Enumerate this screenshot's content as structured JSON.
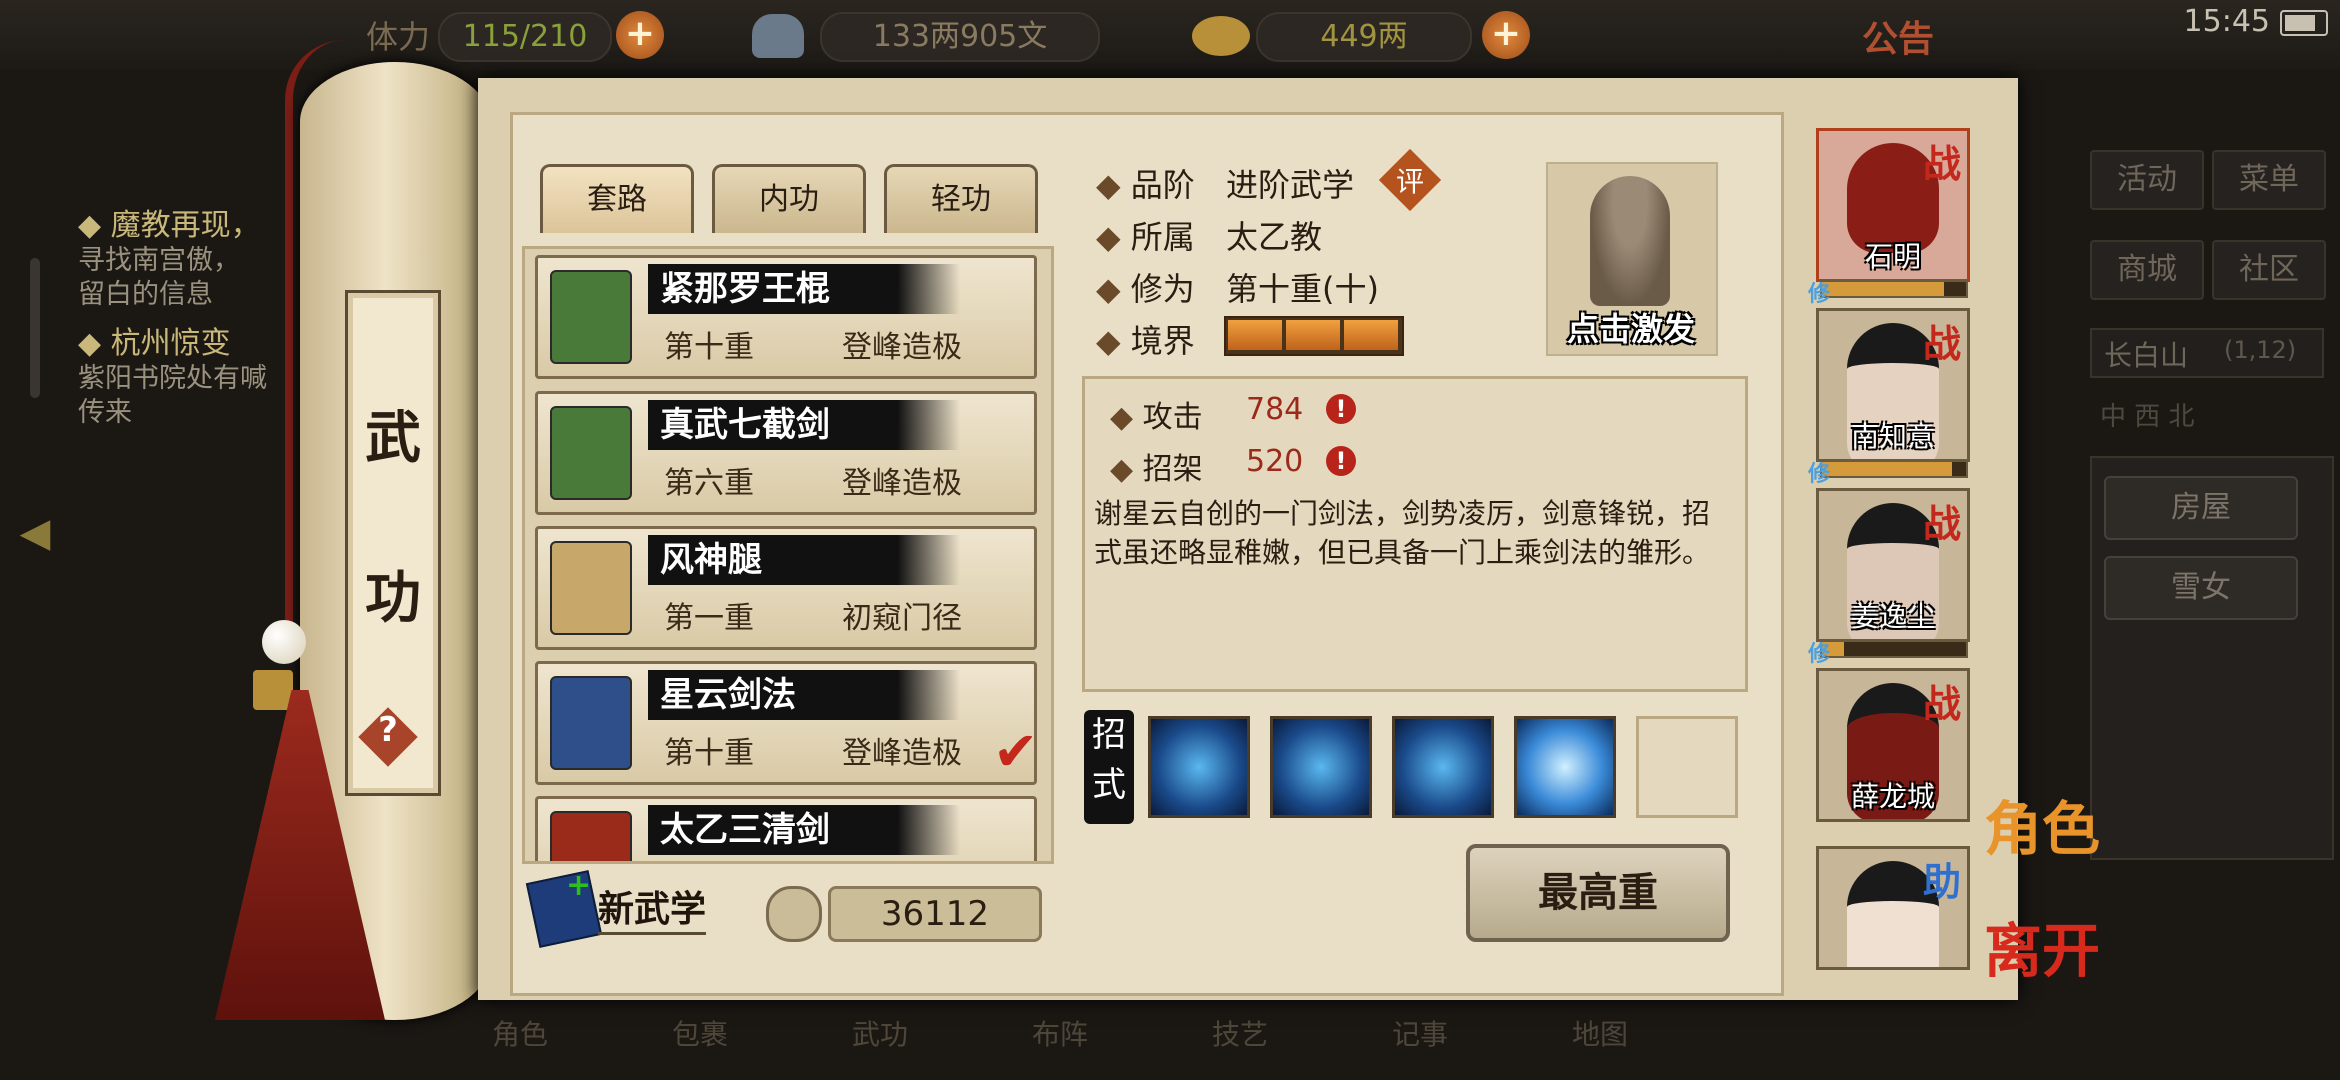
{
  "status_bar": {
    "stamina_label": "体力",
    "stamina_value": "115/210",
    "money": "133两905文",
    "gold": "449两",
    "notice": "公告",
    "clock": "15:45"
  },
  "quests": [
    {
      "title": "◆ 魔教再现，",
      "text": "寻找南宫傲，\n留白的信息"
    },
    {
      "title": "◆ 杭州惊变",
      "text": "紫阳书院处有喊\n传来"
    }
  ],
  "scroll_label": {
    "char1": "武",
    "char2": "功",
    "help": "?"
  },
  "tabs": [
    "套路",
    "内功",
    "轻功"
  ],
  "skills": [
    {
      "name": "紧那罗王棍",
      "level": "第十重",
      "rank": "登峰造极",
      "book_color": "#4a7a3a"
    },
    {
      "name": "真武七截剑",
      "level": "第六重",
      "rank": "登峰造极",
      "book_color": "#4a7a3a"
    },
    {
      "name": "风神腿",
      "level": "第一重",
      "rank": "初窥门径",
      "book_color": "#c8a86a"
    },
    {
      "name": "星云剑法",
      "level": "第十重",
      "rank": "登峰造极",
      "book_color": "#2e4f8a"
    },
    {
      "name": "太乙三清剑",
      "level": "",
      "rank": "",
      "book_color": "#9a2a1a"
    }
  ],
  "new_skill": {
    "label": "新武学",
    "points": "36112"
  },
  "detail": {
    "grade_label": "品阶",
    "grade": "进阶武学",
    "grade_badge": "评",
    "sect_label": "所属",
    "sect": "太乙教",
    "cultivation_label": "修为",
    "cultivation": "第十重(十)",
    "realm_label": "境界",
    "realm_level": 3,
    "realm_max": 3,
    "statue_label": "点击激发",
    "attack_label": "攻击",
    "attack": "784",
    "parry_label": "招架",
    "parry": "520",
    "description": "谢星云自创的一门剑法，剑势凌厉，剑意锋锐，招式虽还略显稚嫩，但已具备一门上乘剑法的雏形。",
    "moves_label": "招式",
    "max_button": "最高重"
  },
  "party": [
    {
      "name": "石明",
      "badge": "战",
      "badge_color": "#c4281c",
      "xp": 0.85,
      "face": "#8a1e16"
    },
    {
      "name": "南知意",
      "badge": "战",
      "badge_color": "#c4281c",
      "xp": 0.9,
      "face": "#e6d2c0"
    },
    {
      "name": "姜逸尘",
      "badge": "战",
      "badge_color": "#c4281c",
      "xp": 0.15,
      "face": "#ddc8b8"
    },
    {
      "name": "薛龙城",
      "badge": "战",
      "badge_color": "#c4281c",
      "xp": 0,
      "face": "#7a1a14"
    },
    {
      "name": "",
      "badge": "助",
      "badge_color": "#2f6fd0",
      "xp": 0,
      "face": "#efe0d2"
    }
  ],
  "xiu_label": "修",
  "side_actions": {
    "role": "角色",
    "leave": "离开"
  },
  "right_menu": {
    "buttons": [
      "活动",
      "菜单",
      "商城",
      "社区"
    ],
    "location": "长白山",
    "coords": "(1,12)",
    "compass": "中 西 北",
    "places": [
      "房屋",
      "雪女"
    ]
  },
  "bottom_nav": [
    "角色",
    "包裹",
    "武功",
    "布阵",
    "技艺",
    "记事",
    "地图"
  ]
}
